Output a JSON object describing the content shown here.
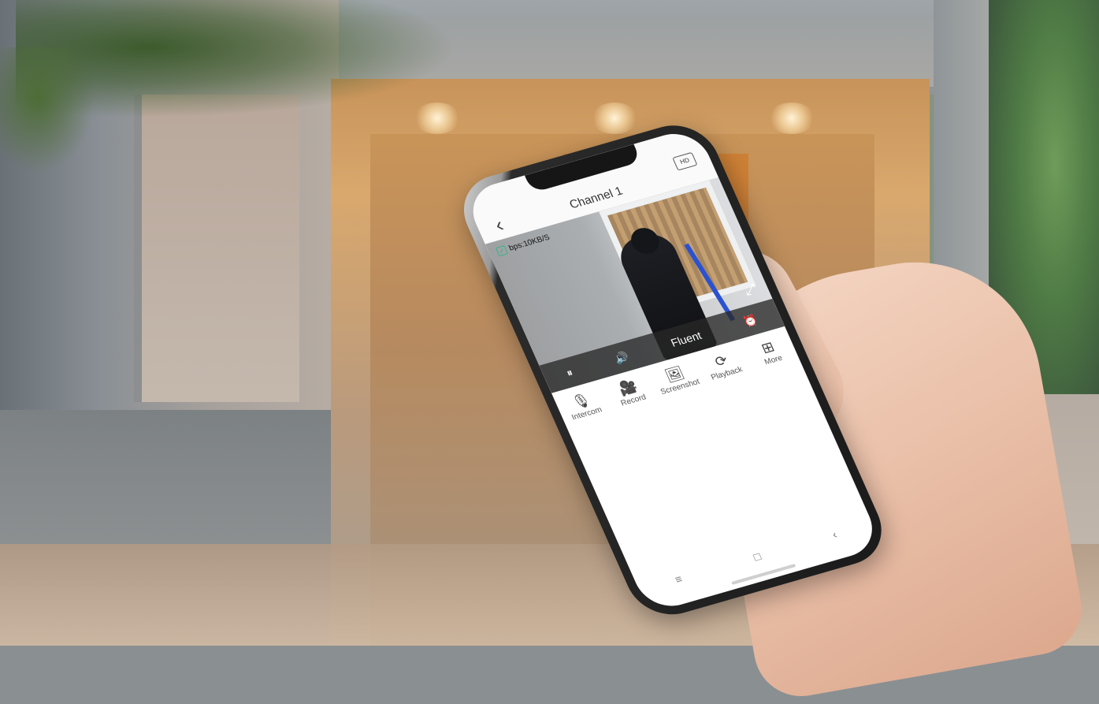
{
  "app": {
    "title": "Channel 1",
    "back_icon": "‹",
    "hd_label": "HD"
  },
  "video": {
    "bitrate": "bps:10KB/S",
    "quality": "Fluent",
    "pause_icon": "⏸",
    "volume_icon": "🔊",
    "alarm_icon": "⏰",
    "fullscreen_icon": "⤢"
  },
  "controls": [
    {
      "label": "Intercom",
      "icon": "microphone-icon",
      "glyph": "🎙"
    },
    {
      "label": "Record",
      "icon": "record-icon",
      "glyph": "🎥"
    },
    {
      "label": "Screenshot",
      "icon": "screenshot-icon",
      "glyph": "🖼"
    },
    {
      "label": "Playback",
      "icon": "playback-icon",
      "glyph": "⟳"
    },
    {
      "label": "More",
      "icon": "grid-icon",
      "glyph": "⊞"
    }
  ],
  "nav": {
    "menu_icon": "≡",
    "home_icon": "□",
    "back_icon": "‹"
  }
}
